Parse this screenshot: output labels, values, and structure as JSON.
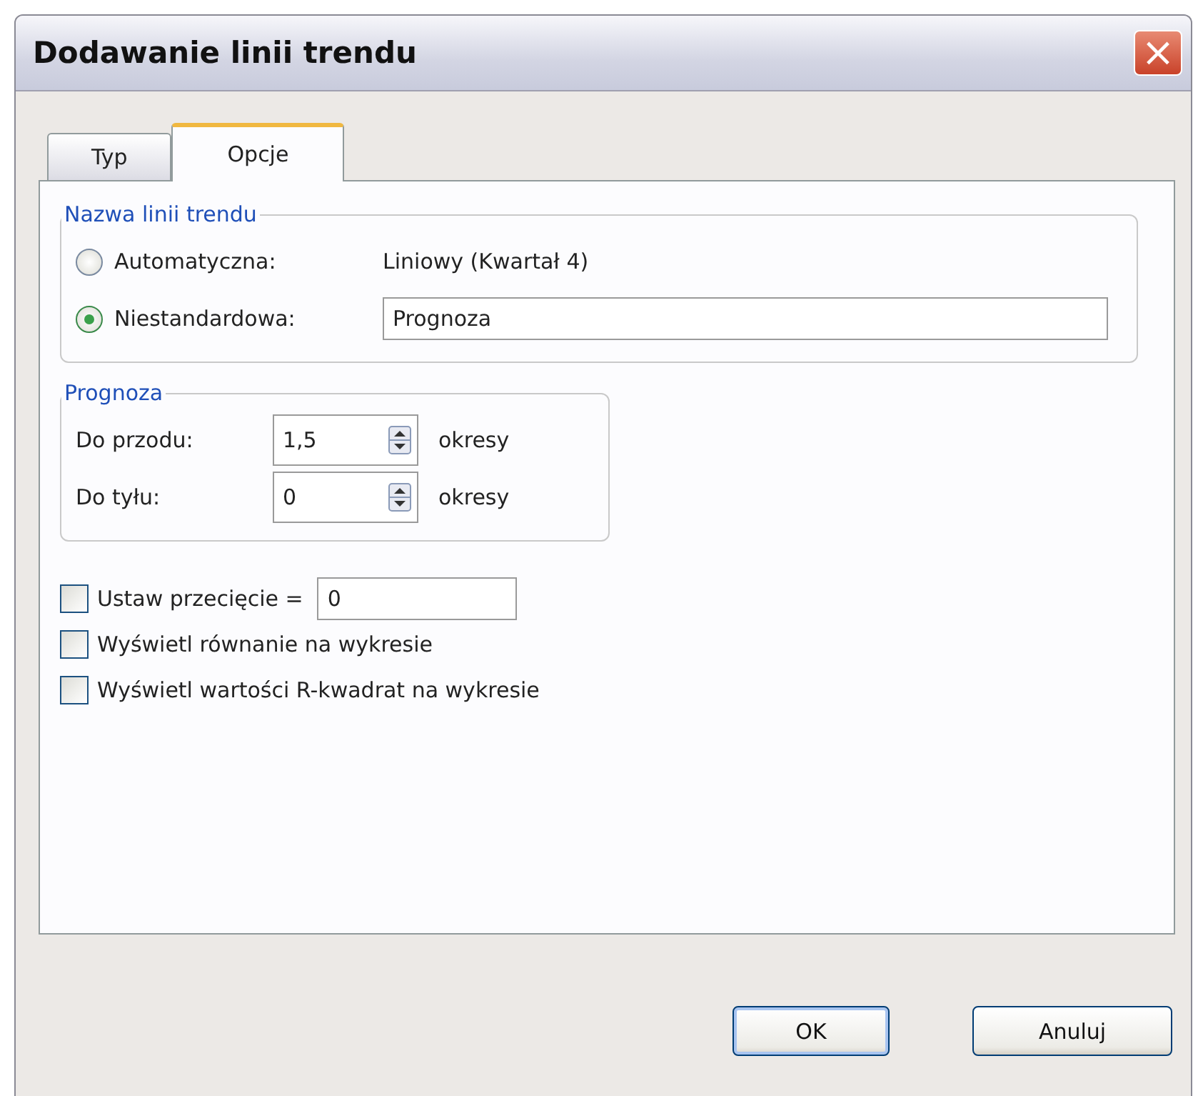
{
  "window": {
    "title": "Dodawanie linii trendu",
    "close_label": "×"
  },
  "tabs": [
    {
      "label": "Typ",
      "selected": false
    },
    {
      "label": "Opcje",
      "selected": true
    }
  ],
  "name_group": {
    "title": "Nazwa linii trendu",
    "options": [
      {
        "label": "Automatyczna:",
        "selected": false,
        "kind": "text",
        "value": "Liniowy (Kwartał 4)"
      },
      {
        "label": "Niestandardowa:",
        "selected": true,
        "kind": "field",
        "value": "Prognoza"
      }
    ]
  },
  "forecast_group": {
    "title": "Prognoza",
    "rows": [
      {
        "label": "Do przodu:",
        "value": "1,5",
        "unit": "okresy"
      },
      {
        "label": "Do tyłu:",
        "value": "0",
        "unit": "okresy"
      }
    ]
  },
  "checkboxes": [
    {
      "label": "Ustaw przecięcie =",
      "checked": false,
      "kind": "field",
      "value": "0"
    },
    {
      "label": "Wyświetl równanie na wykresie",
      "checked": false,
      "kind": "plain"
    },
    {
      "label": "Wyświetl wartości R-kwadrat na wykresie",
      "checked": false,
      "kind": "plain"
    }
  ],
  "buttons": [
    "OK",
    "Anuluj"
  ]
}
